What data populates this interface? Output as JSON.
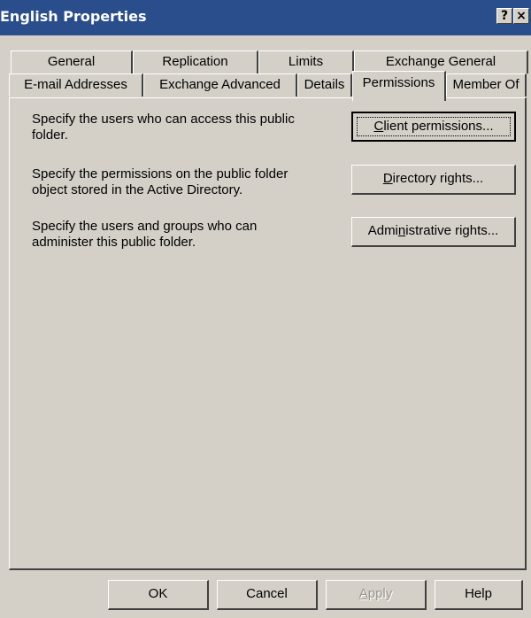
{
  "window": {
    "title": "English Properties",
    "help_label": "?",
    "close_label": "×"
  },
  "tabs": {
    "row1": [
      "General",
      "Replication",
      "Limits",
      "Exchange General"
    ],
    "row2": [
      "E-mail Addresses",
      "Exchange Advanced",
      "Details",
      "Permissions",
      "Member Of"
    ],
    "active": "Permissions"
  },
  "permissions": {
    "client_desc_line1": "Specify the users who can access this public",
    "client_desc_line2": "folder.",
    "client_button": {
      "prefix": "",
      "accel": "C",
      "rest": "lient permissions..."
    },
    "directory_desc_line1": "Specify the permissions on the public folder",
    "directory_desc_line2": "object stored in the Active Directory.",
    "directory_button": {
      "prefix": "",
      "accel": "D",
      "rest": "irectory rights..."
    },
    "admin_desc_line1": "Specify the users and groups who can",
    "admin_desc_line2": "administer this public folder.",
    "admin_button": {
      "prefix": "Admi",
      "accel": "n",
      "rest": "istrative rights..."
    }
  },
  "footer": {
    "ok": "OK",
    "cancel": "Cancel",
    "apply_accel": "A",
    "apply_rest": "pply",
    "help": "Help"
  }
}
